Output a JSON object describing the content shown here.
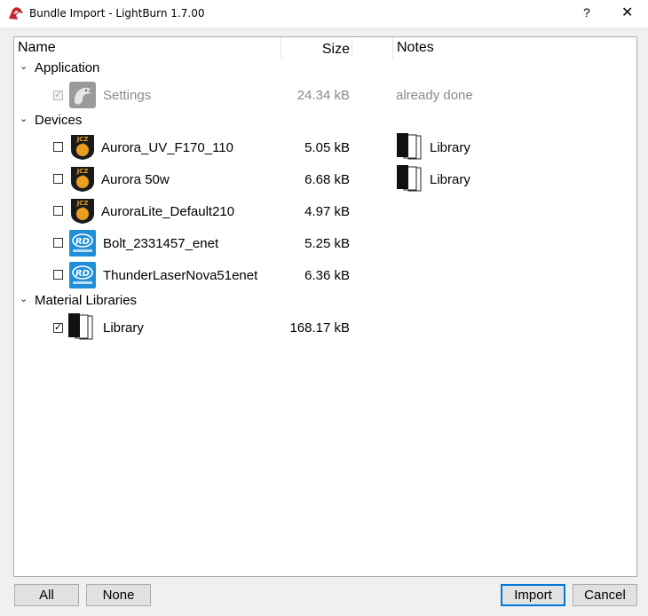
{
  "window": {
    "title": "Bundle Import - LightBurn 1.7.00",
    "help": "?",
    "close": "✕"
  },
  "columns": {
    "name": "Name",
    "size": "Size",
    "notes": "Notes"
  },
  "groups": [
    {
      "label": "Application",
      "items": [
        {
          "label": "Settings",
          "size": "24.34 kB",
          "note": "already done",
          "checked": true,
          "disabled": true,
          "icon": "lightburn-dragon-icon"
        }
      ]
    },
    {
      "label": "Devices",
      "items": [
        {
          "label": "Aurora_UV_F170_110",
          "size": "5.05 kB",
          "note": "Library",
          "checked": false,
          "icon": "jcz-icon"
        },
        {
          "label": "Aurora 50w",
          "size": "6.68 kB",
          "note": "Library",
          "checked": false,
          "icon": "jcz-icon"
        },
        {
          "label": "AuroraLite_Default210",
          "size": "4.97 kB",
          "note": "",
          "checked": false,
          "icon": "jcz-icon"
        },
        {
          "label": "Bolt_2331457_enet",
          "size": "5.25 kB",
          "note": "",
          "checked": false,
          "icon": "ruida-icon"
        },
        {
          "label": "ThunderLaserNova51enet",
          "size": "6.36 kB",
          "note": "",
          "checked": false,
          "icon": "ruida-icon"
        }
      ]
    },
    {
      "label": "Material Libraries",
      "items": [
        {
          "label": "Library",
          "size": "168.17 kB",
          "note": "",
          "checked": true,
          "icon": "library-icon"
        }
      ]
    }
  ],
  "buttons": {
    "all": "All",
    "none": "None",
    "import": "Import",
    "cancel": "Cancel"
  },
  "colors": {
    "accent": "#0078d7",
    "ruida_blue": "#1e8fd8",
    "jcz_gold": "#e8a020"
  }
}
